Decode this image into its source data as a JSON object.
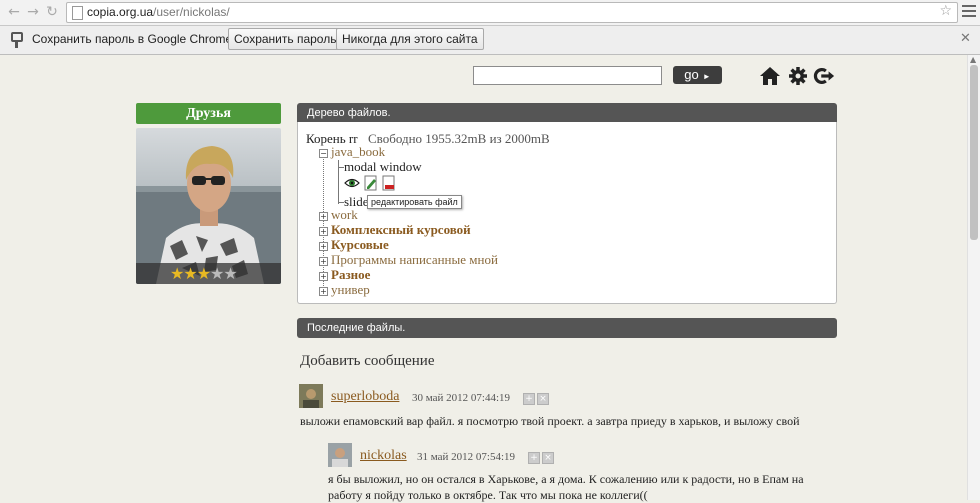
{
  "browser": {
    "url_host": "copia.org.ua",
    "url_path": "/user/nickolas/"
  },
  "infobar": {
    "message": "Сохранить пароль в Google Chrome?",
    "save_label": "Сохранить пароль",
    "never_label": "Никогда для этого сайта"
  },
  "header": {
    "search_value": "",
    "go_label": "go"
  },
  "profile": {
    "friends_label": "Друзья",
    "rating": 3,
    "rating_max": 5
  },
  "file_tree": {
    "panel_title": "Дерево файлов.",
    "root_label": "Корень rr",
    "free_space": "Свободно 1955.32mB из 2000mB",
    "expanded_folder": "java_book",
    "children": [
      "modal window",
      "slide"
    ],
    "folders": [
      {
        "label": "work",
        "bold": false
      },
      {
        "label": "Комплексный курсовой",
        "bold": true
      },
      {
        "label": "Курсовые",
        "bold": true
      },
      {
        "label": "Программы написанные мной",
        "bold": false
      },
      {
        "label": "Разное",
        "bold": true
      },
      {
        "label": "универ",
        "bold": false
      }
    ],
    "tooltip": "редактировать файл"
  },
  "recent": {
    "panel_title": "Последние файлы.",
    "add_message": "Добавить сообщение"
  },
  "messages": [
    {
      "user": "superloboda",
      "date": "30 май 2012 07:44:19",
      "text": "выложи епамовский вар файл. я посмотрю твой проект. а завтра приеду в харьков, и выложу свой"
    },
    {
      "user": "nickolas",
      "date": "31 май 2012 07:54:19",
      "text": "я бы выложил, но он остался в Харькове, а я дома. К сожалению или к радости, но в Епам на работу я пойду только в октябре. Так что мы пока не коллеги(("
    }
  ]
}
